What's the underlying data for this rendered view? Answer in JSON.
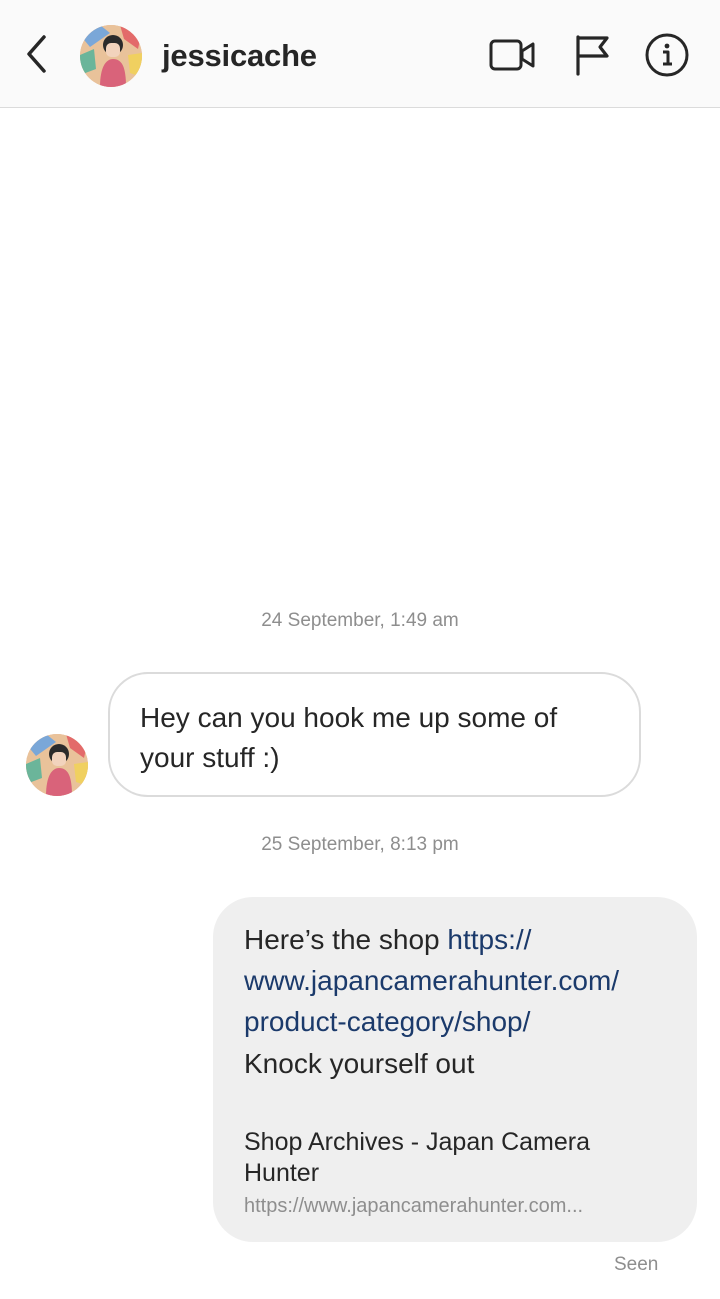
{
  "header": {
    "username": "jessicache"
  },
  "icons": {
    "back": "chevron-left-icon",
    "video": "video-camera-icon",
    "report": "flag-icon",
    "info": "info-circle-icon"
  },
  "conversation": {
    "timestamp_1": "24 September, 1:49 am",
    "incoming_message": "Hey can you hook me up some of your stuff :)",
    "timestamp_2": "25 September, 8:13 pm",
    "outgoing": {
      "text_prefix": "Here’s the shop ",
      "link": "https://www.japancamerahunter.com/product-category/shop/",
      "link_line1": "https://",
      "link_line2": "www.japancamerahunter.com/",
      "link_line3": "product-category/shop/",
      "text_suffix": "Knock yourself out",
      "preview_title": "Shop Archives - Japan Camera Hunter",
      "preview_url": "https://www.japancamerahunter.com..."
    },
    "status": "Seen"
  },
  "colors": {
    "link": "#1b3a6b",
    "bubble_out_bg": "#efefef",
    "bubble_in_border": "#dbdbdb",
    "muted_text": "#8e8e8e"
  }
}
